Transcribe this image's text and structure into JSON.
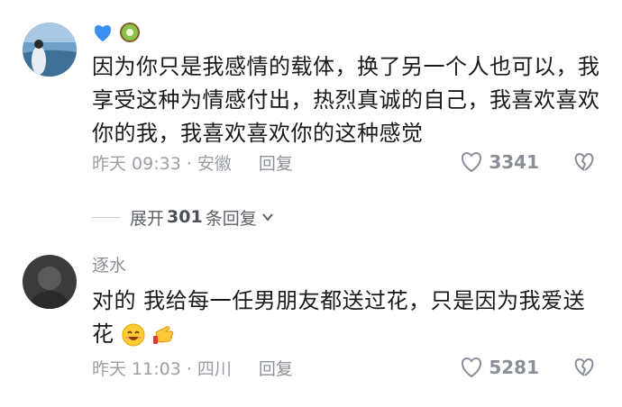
{
  "comments": [
    {
      "badges": [
        "blue-heart-icon",
        "kiwi-icon"
      ],
      "text": "因为你只是我感情的载体，换了另一个人也可以，我享受这种为情感付出，热烈真诚的自己，我喜欢喜欢你的我，我喜欢喜欢你的这种感觉",
      "time_location": "昨天 09:33 · 安徽",
      "reply_label": "回复",
      "likes": "3341"
    },
    {
      "username": "逐水",
      "text": "对的 我给每一任男朋友都送过花，只是因为我爱送花",
      "emojis": [
        "grinning-face-icon",
        "pointing-hand-icon"
      ],
      "time_location": "昨天 11:03 · 四川",
      "reply_label": "回复",
      "likes": "5281"
    }
  ],
  "expand_replies": {
    "prefix": "展开",
    "count": "301",
    "suffix": "条回复"
  },
  "colors": {
    "text": "#1a1a1a",
    "meta": "#9a9fa6",
    "badge_heart": "#3a8ff0",
    "kiwi": "#7cb342"
  }
}
